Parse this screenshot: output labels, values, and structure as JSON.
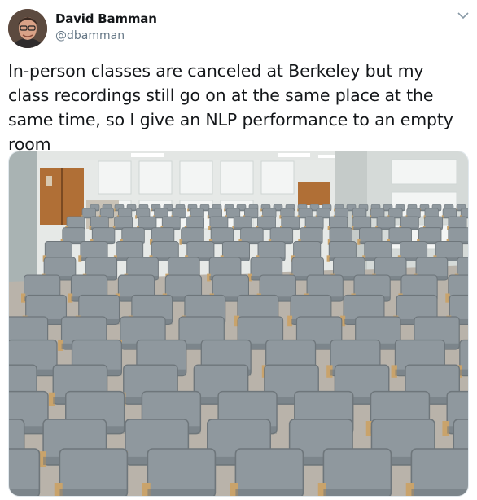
{
  "author": {
    "display_name": "David Bamman",
    "handle": "@dbamman",
    "avatar_icon": "profile-photo"
  },
  "menu": {
    "icon": "chevron-down-icon"
  },
  "tweet": {
    "text": "In-person classes are canceled at Berkeley but my class recordings still go on at the same place at the same time, so I give an NLP performance to an empty room"
  },
  "media": {
    "description_icon": "photo-lecture-hall",
    "colors": {
      "seat": "#8f989e",
      "seat_dark": "#6e767b",
      "wood": "#c9a36b",
      "wall": "#e7eae8",
      "floor": "#b7b1a8"
    }
  }
}
